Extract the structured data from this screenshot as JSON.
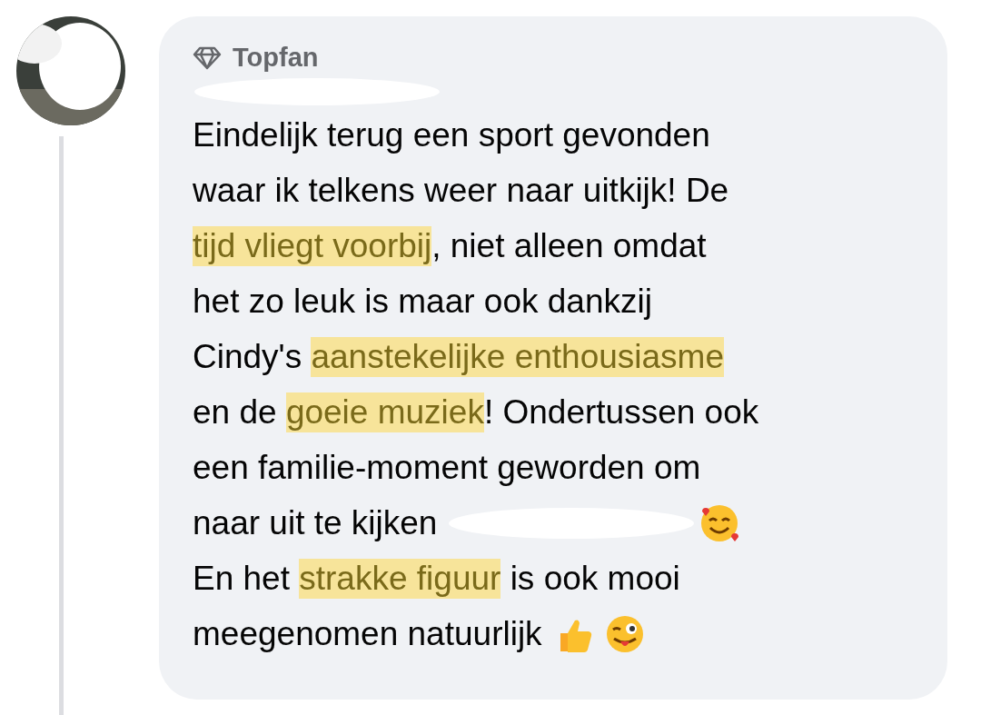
{
  "badge": {
    "label": "Topfan"
  },
  "comment": {
    "lines": [
      [
        {
          "kind": "text",
          "text": "Eindelijk terug een sport gevonden",
          "highlighted": false
        }
      ],
      [
        {
          "kind": "text",
          "text": "waar ik telkens weer naar uitkijk! De",
          "highlighted": false
        }
      ],
      [
        {
          "kind": "text",
          "text": "tijd vliegt voorbij",
          "highlighted": true
        },
        {
          "kind": "text",
          "text": ", niet alleen omdat",
          "highlighted": false
        }
      ],
      [
        {
          "kind": "text",
          "text": "het zo leuk is maar ook dankzij",
          "highlighted": false
        }
      ],
      [
        {
          "kind": "text",
          "text": "Cindy's ",
          "highlighted": false
        },
        {
          "kind": "text",
          "text": "aanstekelijke enthousiasme",
          "highlighted": true
        }
      ],
      [
        {
          "kind": "text",
          "text": "en de ",
          "highlighted": false
        },
        {
          "kind": "text",
          "text": "goeie muziek",
          "highlighted": true
        },
        {
          "kind": "text",
          "text": "! Ondertussen ook",
          "highlighted": false
        }
      ],
      [
        {
          "kind": "text",
          "text": "een familie-moment geworden om",
          "highlighted": false
        }
      ],
      [
        {
          "kind": "text",
          "text": "naar uit te kijken ",
          "highlighted": false
        },
        {
          "kind": "redaction"
        },
        {
          "kind": "emoji_love"
        }
      ],
      [
        {
          "kind": "text",
          "text": "En het ",
          "highlighted": false
        },
        {
          "kind": "text",
          "text": "strakke figuur",
          "highlighted": true
        },
        {
          "kind": "text",
          "text": " is ook mooi",
          "highlighted": false
        }
      ],
      [
        {
          "kind": "text",
          "text": "meegenomen natuurlijk ",
          "highlighted": false
        },
        {
          "kind": "emoji_thumbs"
        },
        {
          "kind": "emoji_wink"
        }
      ]
    ]
  }
}
